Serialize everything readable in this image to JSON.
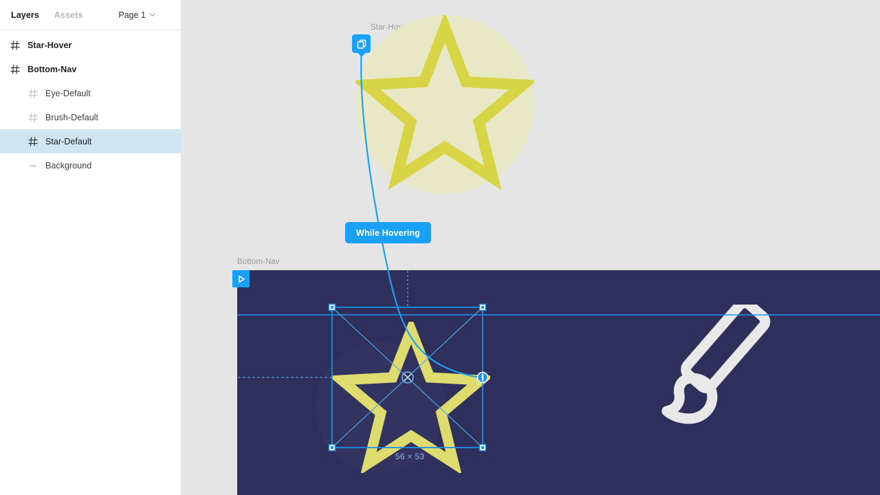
{
  "sidebar": {
    "tabs": [
      {
        "label": "Layers",
        "active": true
      },
      {
        "label": "Assets",
        "active": false
      }
    ],
    "page_selector": {
      "label": "Page 1",
      "icon": "chevron-down-icon"
    },
    "layers": [
      {
        "name": "Star-Hover",
        "icon": "frame-icon",
        "indent": 0,
        "selected": false,
        "bold": true
      },
      {
        "name": "Bottom-Nav",
        "icon": "frame-icon",
        "indent": 0,
        "selected": false,
        "bold": true
      },
      {
        "name": "Eye-Default",
        "icon": "frame-icon-dim",
        "indent": 1,
        "selected": false,
        "bold": false
      },
      {
        "name": "Brush-Default",
        "icon": "frame-icon-dim",
        "indent": 1,
        "selected": false,
        "bold": false
      },
      {
        "name": "Star-Default",
        "icon": "frame-icon",
        "indent": 1,
        "selected": true,
        "bold": false
      },
      {
        "name": "Background",
        "icon": "rectangle-icon",
        "indent": 1,
        "selected": false,
        "bold": false
      }
    ]
  },
  "canvas": {
    "frames": [
      {
        "label": "Star-Hover"
      },
      {
        "label": "Bottom-Nav"
      }
    ],
    "prototype": {
      "badge_icon": "overlay-swap-icon",
      "play_icon": "play-icon",
      "interaction_label": "While Hovering"
    },
    "selection": {
      "dimensions": "56 × 53",
      "width": 56,
      "height": 53,
      "handles": [
        "top-left",
        "top-right",
        "bottom-left",
        "bottom-right",
        "right-middle",
        "center-rotate"
      ]
    }
  },
  "colors": {
    "accent_blue": "#1aa0f5",
    "selection_blue": "#2196f3",
    "canvas_gray": "#e5e5e5",
    "nav_navy": "#2f2f5c",
    "nav_circle": "#33335f",
    "star_yellow": "#d7d546",
    "hover_circle_cream": "#e8e8c7",
    "brush_white": "#e8e8e8",
    "selected_row": "#cfe5f2",
    "dim_label_blue": "#8fb9e8"
  }
}
